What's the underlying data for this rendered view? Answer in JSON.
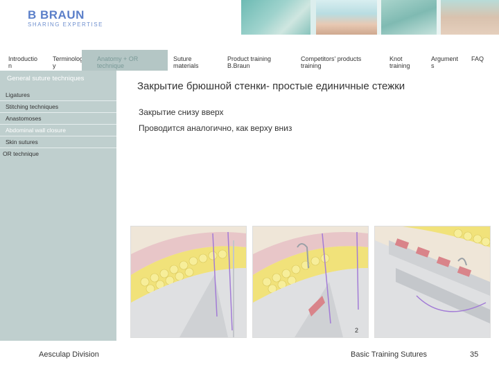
{
  "header": {
    "brand": "B BRAUN",
    "tagline": "SHARING EXPERTISE"
  },
  "nav": [
    {
      "line1": "Introductio",
      "line2": "n",
      "active": false
    },
    {
      "line1": "Terminolog",
      "line2": "y",
      "active": false
    },
    {
      "line1": "Anatomy + OR",
      "line2": "technique",
      "active": true
    },
    {
      "line1": "Suture",
      "line2": "materials",
      "active": false
    },
    {
      "line1": "Product training",
      "line2": "B.Braun",
      "active": false
    },
    {
      "line1": "Competitors' products",
      "line2": "training",
      "active": false
    },
    {
      "line1": "Knot",
      "line2": "training",
      "active": false
    },
    {
      "line1": "Argument",
      "line2": "s",
      "active": false
    },
    {
      "line1": "FAQ",
      "line2": "",
      "active": false
    }
  ],
  "sidebar": {
    "heading": "General suture techniques",
    "items": [
      {
        "label": "Ligatures",
        "active": false
      },
      {
        "label": "Stitching techniques",
        "active": false
      },
      {
        "label": "Anastomoses",
        "active": false
      },
      {
        "label": "Abdominal wall closure",
        "active": true
      },
      {
        "label": "Skin sutures",
        "active": false
      }
    ],
    "section": "OR technique"
  },
  "content": {
    "title": "Закрытие брюшной стенки- простые единичные стежки",
    "line1": "Закрытие снизу вверх",
    "line2": "Проводится аналогично, как верху вниз",
    "figure_number": "2"
  },
  "footer": {
    "left": "Aesculap Division",
    "center": "Basic Training Sutures",
    "page": "35"
  },
  "colors": {
    "brand": "#5b7fc9",
    "sidebar": "#bfcfce",
    "nav_active": "#b4c6c5"
  }
}
